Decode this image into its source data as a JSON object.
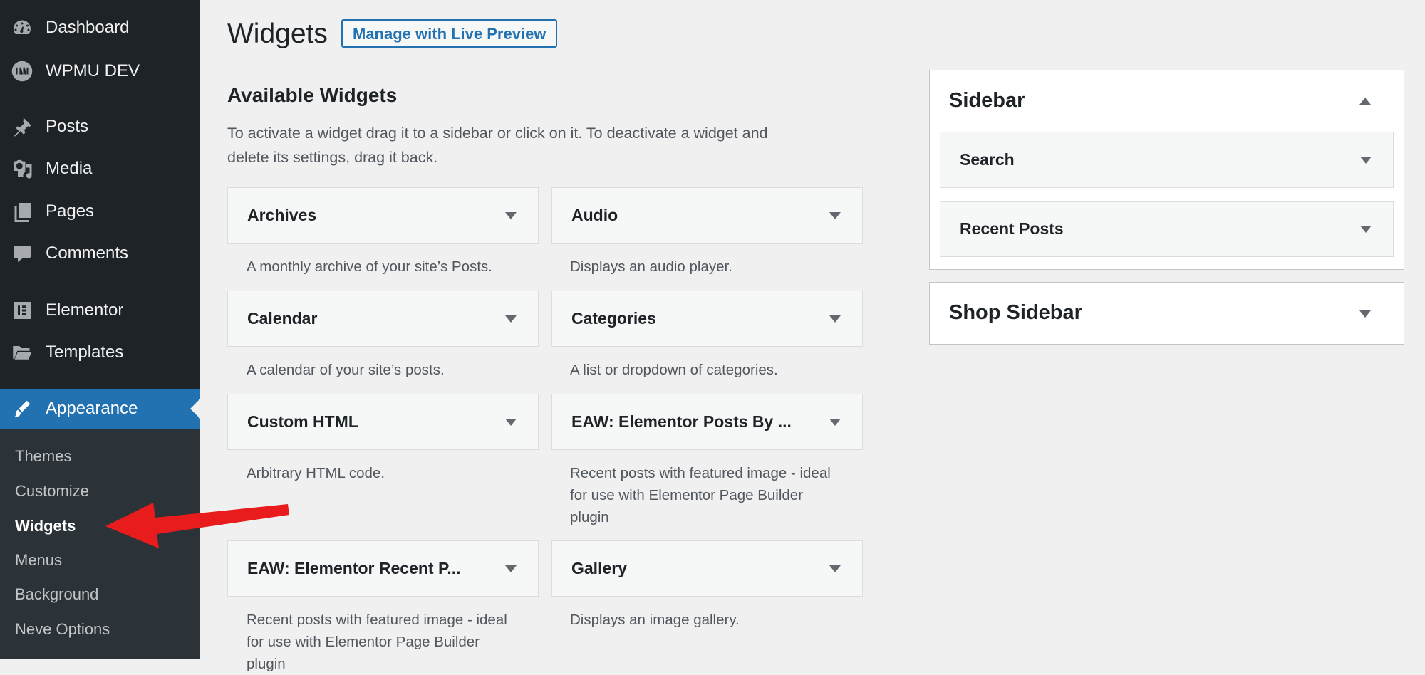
{
  "sidebar": {
    "items": [
      {
        "label": "Dashboard",
        "icon": "dashboard-icon"
      },
      {
        "label": "WPMU DEV",
        "icon": "wpmudev-icon"
      },
      {
        "label": "Posts",
        "icon": "pin-icon"
      },
      {
        "label": "Media",
        "icon": "media-icon"
      },
      {
        "label": "Pages",
        "icon": "pages-icon"
      },
      {
        "label": "Comments",
        "icon": "comment-icon"
      },
      {
        "label": "Elementor",
        "icon": "elementor-icon"
      },
      {
        "label": "Templates",
        "icon": "folder-icon"
      },
      {
        "label": "Appearance",
        "icon": "paintbrush-icon"
      }
    ],
    "submenu": [
      "Themes",
      "Customize",
      "Widgets",
      "Menus",
      "Background",
      "Neve Options"
    ]
  },
  "header": {
    "title": "Widgets",
    "live_preview_label": "Manage with Live Preview"
  },
  "available": {
    "title": "Available Widgets",
    "intro": "To activate a widget drag it to a sidebar or click on it. To deactivate a widget and delete its settings, drag it back.",
    "widgets": [
      {
        "title": "Archives",
        "desc": "A monthly archive of your site’s Posts."
      },
      {
        "title": "Audio",
        "desc": "Displays an audio player."
      },
      {
        "title": "Calendar",
        "desc": "A calendar of your site’s posts."
      },
      {
        "title": "Categories",
        "desc": "A list or dropdown of categories."
      },
      {
        "title": "Custom HTML",
        "desc": "Arbitrary HTML code."
      },
      {
        "title": "EAW: Elementor Posts By ...",
        "desc": "Recent posts with featured image - ideal for use with Elementor Page Builder plugin"
      },
      {
        "title": "EAW: Elementor Recent P...",
        "desc": "Recent posts with featured image - ideal for use with Elementor Page Builder plugin"
      },
      {
        "title": "Gallery",
        "desc": "Displays an image gallery."
      }
    ]
  },
  "sidebars": [
    {
      "title": "Sidebar",
      "expanded": true,
      "widgets": [
        "Search",
        "Recent Posts"
      ]
    },
    {
      "title": "Shop Sidebar",
      "expanded": false,
      "widgets": []
    }
  ],
  "colors": {
    "menu_bg": "#1d2327",
    "submenu_bg": "#2c3338",
    "accent": "#2271b1",
    "annotation": "#e81c1c"
  }
}
